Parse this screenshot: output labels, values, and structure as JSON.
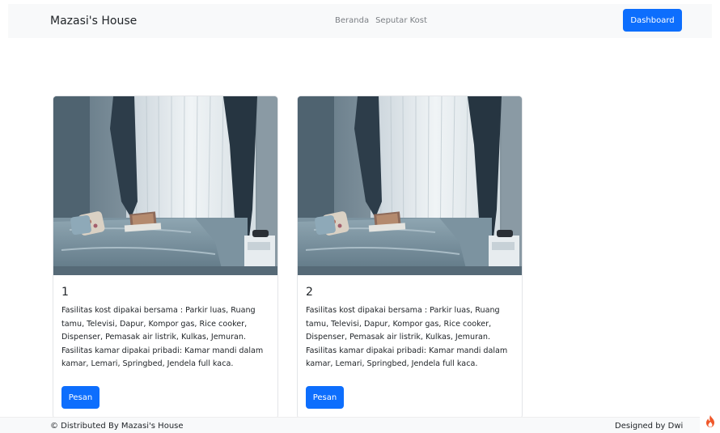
{
  "navbar": {
    "brand": "Mazasi's House",
    "links": [
      "Beranda",
      "Seputar Kost"
    ],
    "dashboard_label": "Dashboard"
  },
  "cards": [
    {
      "title": "1",
      "description": "Fasilitas kost dipakai bersama : Parkir luas, Ruang tamu, Televisi, Dapur, Kompor gas, Rice cooker, Dispenser, Pemasak air listrik, Kulkas, Jemuran. Fasilitas kamar dipakai pribadi: Kamar mandi dalam kamar, Lemari, Springbed, Jendela full kaca.",
      "button_label": "Pesan",
      "image": "bedroom-photo"
    },
    {
      "title": "2",
      "description": "Fasilitas kost dipakai bersama : Parkir luas, Ruang tamu, Televisi, Dapur, Kompor gas, Rice cooker, Dispenser, Pemasak air listrik, Kulkas, Jemuran. Fasilitas kamar dipakai pribadi: Kamar mandi dalam kamar, Lemari, Springbed, Jendela full kaca.",
      "button_label": "Pesan",
      "image": "bedroom-photo"
    }
  ],
  "footer": {
    "left": "© Distributed By Mazasi's House",
    "right": "Designed by Dwi"
  },
  "colors": {
    "primary": "#0d6efd",
    "navbar_bg": "#f8f9fa",
    "flame": "#f0582a"
  },
  "icons": {
    "corner": "flame-icon"
  }
}
